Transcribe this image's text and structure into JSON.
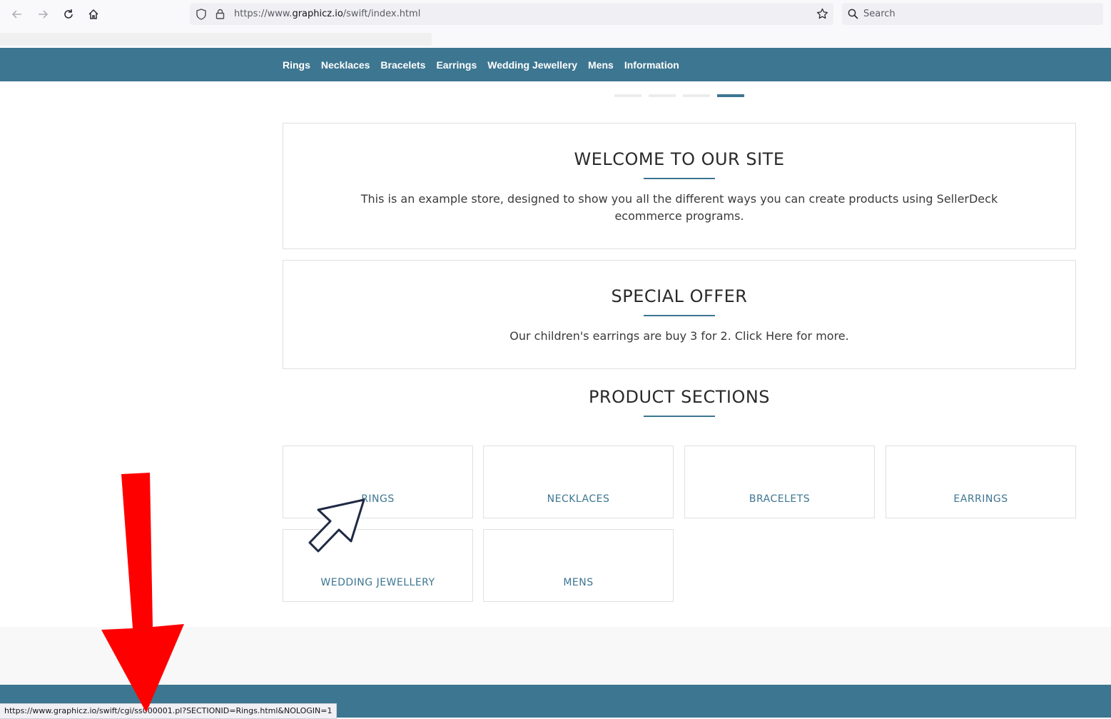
{
  "browser": {
    "url_prefix": "https://www.",
    "url_domain": "graphicz.io",
    "url_path": "/swift/index.html",
    "search_placeholder": "Search",
    "status_url": "https://www.graphicz.io/swift/cgi/ss000001.pl?SECTIONID=Rings.html&NOLOGIN=1"
  },
  "nav": {
    "items": [
      "Rings",
      "Necklaces",
      "Bracelets",
      "Earrings",
      "Wedding Jewellery",
      "Mens",
      "Information"
    ]
  },
  "slider": {
    "slide_count": 4,
    "active_index": 3
  },
  "welcome": {
    "title": "WELCOME TO OUR SITE",
    "text": "This is an example store, designed to show you all the different ways you can create products using SellerDeck ecommerce programs."
  },
  "offer": {
    "title": "SPECIAL OFFER",
    "text": "Our children's earrings are buy 3 for 2. Click Here for more."
  },
  "sections": {
    "title": "PRODUCT SECTIONS",
    "items": [
      "RINGS",
      "NECKLACES",
      "BRACELETS",
      "EARRINGS",
      "WEDDING JEWELLERY",
      "MENS"
    ]
  },
  "colors": {
    "brand": "#3d7691",
    "annotation_arrow": "#ff0000",
    "cursor_outline": "#1f2a44"
  }
}
